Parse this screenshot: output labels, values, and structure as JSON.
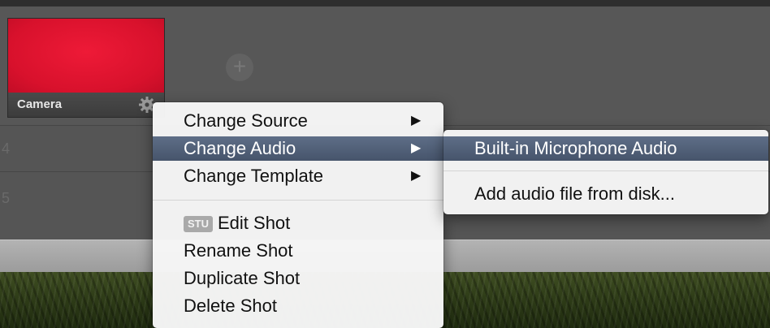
{
  "shots": {
    "camera": {
      "label": "Camera",
      "color": "#e1132f"
    },
    "add_icon": "plus-circle-icon",
    "rows": [
      {
        "number": "4"
      },
      {
        "number": "5"
      }
    ]
  },
  "context_menu": {
    "items": [
      {
        "label": "Change Source",
        "has_submenu": true
      },
      {
        "label": "Change Audio",
        "has_submenu": true,
        "highlighted": true
      },
      {
        "label": "Change Template",
        "has_submenu": true
      },
      {
        "label": "Edit Shot",
        "badge": "STU"
      },
      {
        "label": "Rename Shot"
      },
      {
        "label": "Duplicate Shot"
      },
      {
        "label": "Delete Shot"
      }
    ],
    "arrow_glyph": "▶"
  },
  "audio_submenu": {
    "items": [
      {
        "label": "Built-in Microphone Audio",
        "highlighted": true
      },
      {
        "label": "Add audio file from disk..."
      }
    ]
  },
  "colors": {
    "highlight": "#52617a",
    "menu_bg": "#f5f5f5"
  }
}
